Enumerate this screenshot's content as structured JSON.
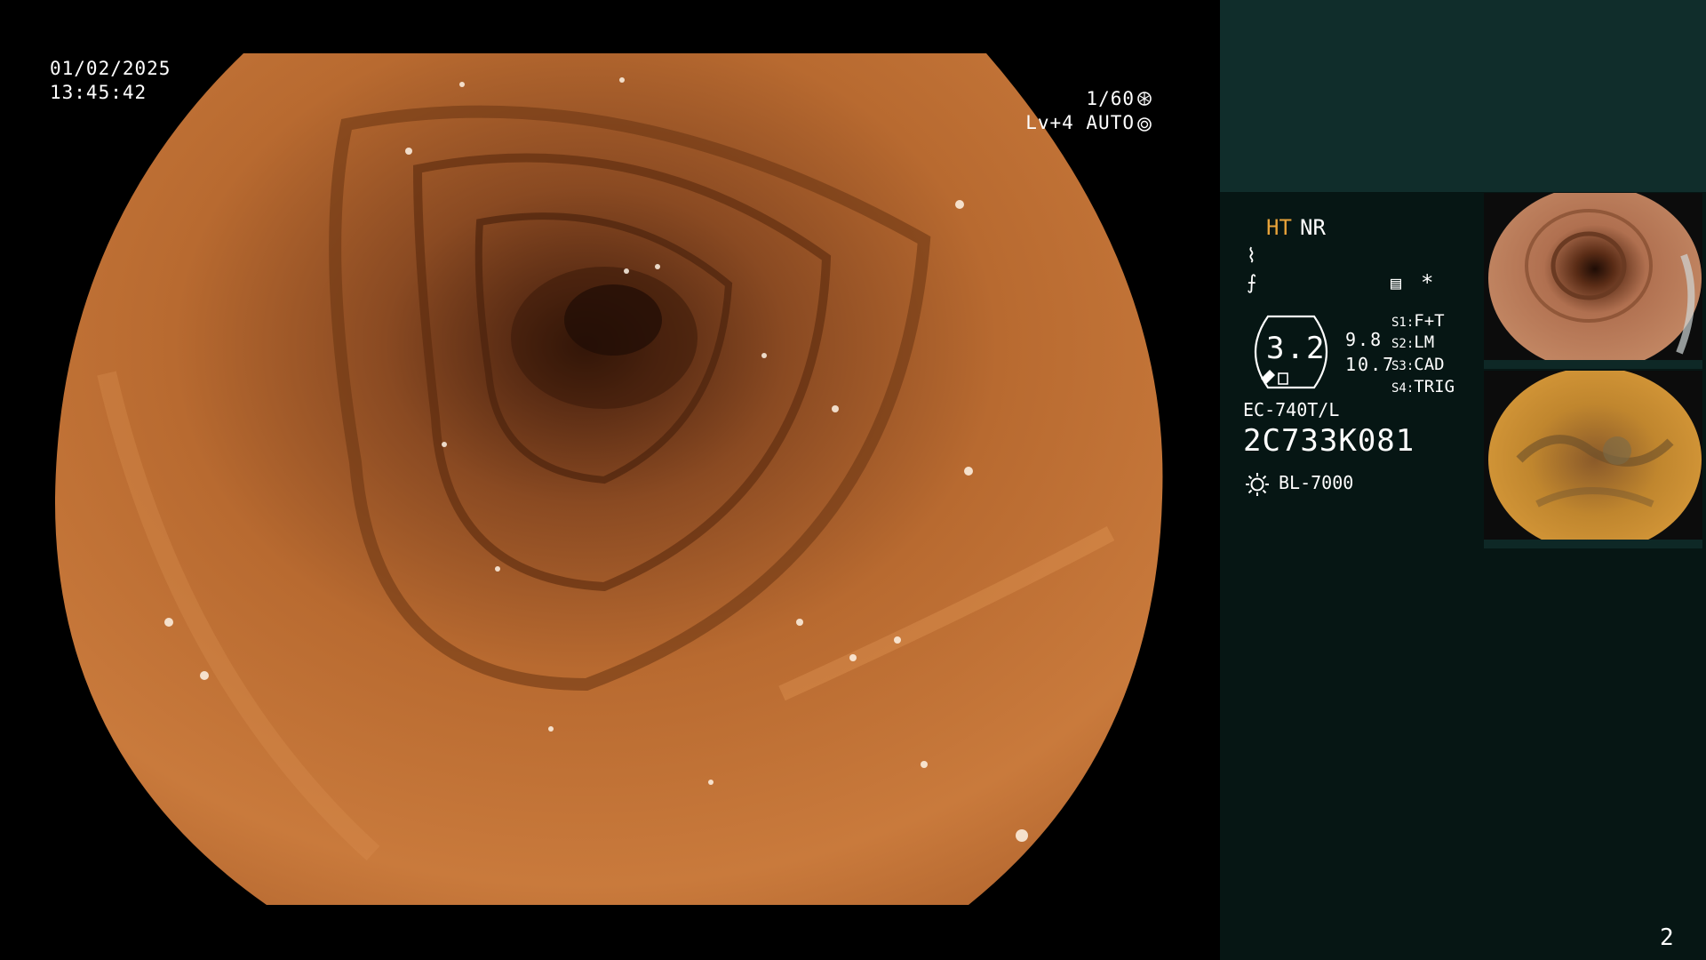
{
  "overlay": {
    "date": "01/02/2025",
    "time": "13:45:42",
    "shutter": "1/60",
    "exposure": "Lv+4 AUTO"
  },
  "panel": {
    "mode_ht": "HT",
    "mode_nr": "NR",
    "enhance_icon_1": "structure-enhance-icon",
    "enhance_icon_2": "color-enhance-icon",
    "zoom_value": "3.2",
    "value_a": "9.8",
    "value_b": "10.7",
    "switches": [
      {
        "key": "S1",
        "value": "F+T"
      },
      {
        "key": "S2",
        "value": "LM"
      },
      {
        "key": "S3",
        "value": "CAD"
      },
      {
        "key": "S4",
        "value": "TRIG"
      }
    ],
    "scope_model": "EC-740T/L",
    "scope_serial": "2C733K081",
    "light_source": "BL-7000",
    "star": "*"
  },
  "page_number": "2",
  "colors": {
    "panel_bg": "#061614",
    "panel_top": "#102d2b",
    "ht_accent": "#e8a33a",
    "tissue": "#b86a30"
  }
}
